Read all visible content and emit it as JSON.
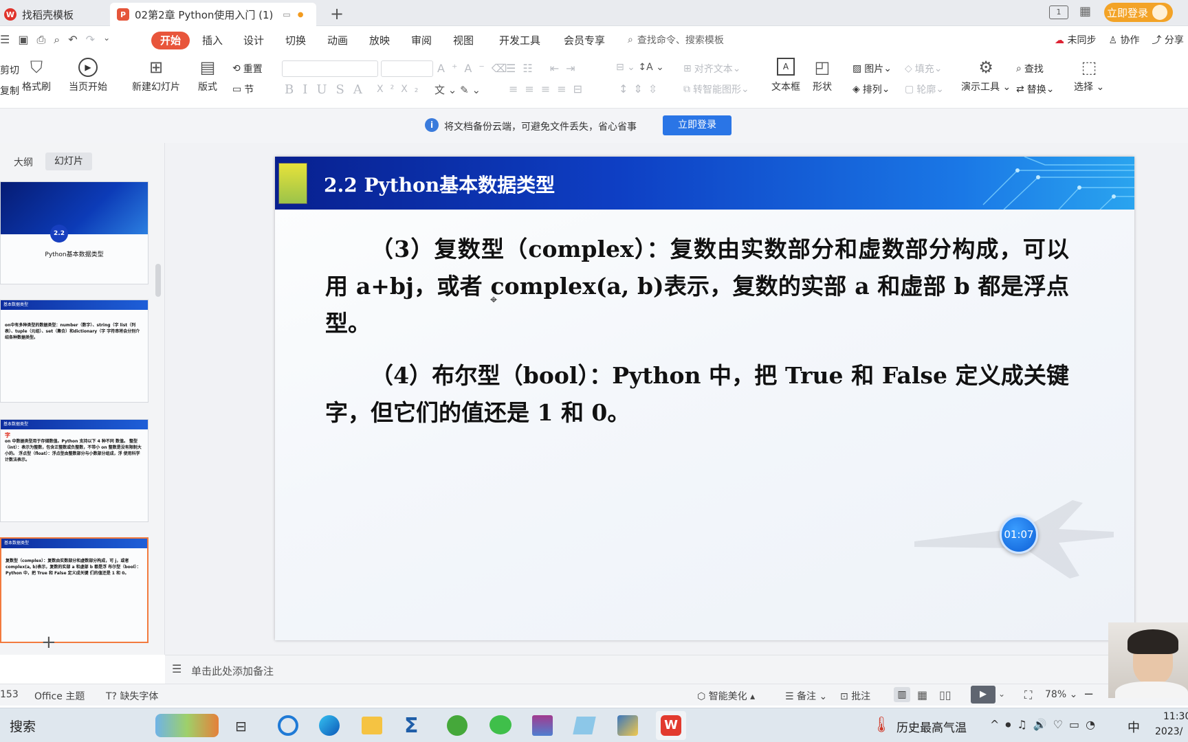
{
  "tabs": [
    {
      "label": "找稻壳模板",
      "icon": "wps-icon"
    },
    {
      "label": "02第2章  Python使用入门 (1)",
      "icon": "ppt-icon"
    }
  ],
  "header_right": {
    "login": "立即登录"
  },
  "ribbon_tabs": [
    "开始",
    "插入",
    "设计",
    "切换",
    "动画",
    "放映",
    "审阅",
    "视图",
    "开发工具",
    "会员专享"
  ],
  "search": {
    "placeholder": "查找命令、搜索模板"
  },
  "top_right": {
    "sync": "未同步",
    "collab": "协作",
    "share": "分享"
  },
  "ribbon": {
    "cut": "剪切",
    "copy": "复制",
    "format_painter": "格式刷",
    "start_from_current": "当页开始",
    "new_slide": "新建幻灯片",
    "layout": "版式",
    "reset": "重置",
    "section": "节",
    "align_text": "对齐文本",
    "smart_art": "转智能图形",
    "textbox": "文本框",
    "shape": "形状",
    "picture": "图片",
    "arrange": "排列",
    "fill": "填充",
    "outline": "轮廓",
    "presentation_tools": "演示工具",
    "find": "查找",
    "replace": "替换",
    "select": "选择"
  },
  "notice": {
    "text": "将文档备份云端，可避免文件丢失，省心省事",
    "button": "立即登录"
  },
  "left_panel": {
    "tab_outline": "大纲",
    "tab_slides": "幻灯片",
    "thumb1_badge": "2.2",
    "thumb1_title": "Python基本数据类型",
    "thumb_header": "基本数据类型",
    "thumb2_text": "on中有多种类型的数据类型：number（数字）、string（字 list（列表）、tuple（元组）、set（集合）和dictionary（字 字符串将会分别介绍各种数据类型。",
    "thumb3_heading": "字",
    "thumb3_text": "on 中数据类型用于存储数值。Python 支持以下 4 种不同 数值。 整型（int）：表示为整数，包含正整数或负整数，不带小 on 整数是没有限制大小的。 浮点型（float）：浮点型由整数部分与小数部分组成，浮 使用科学计数法表示。",
    "thumb4_text": "复数型（complex）：复数由实数部分和虚数部分构成，可 j，或者 complex(a, b)表示，复数的实部 a 和虚部 b 都是浮 布尔型（bool）：Python 中，把 True 和 False 定义成关键 们的值还是 1 和 0。"
  },
  "slide": {
    "title": "2.2 Python基本数据类型",
    "paragraph1": "（3）复数型（complex）：复数由实数部分和虚数部分构成，可以用 a+bj，或者 complex(a, b)表示，复数的实部 a 和虚部 b 都是浮点型。",
    "paragraph2": "（4）布尔型（bool）：Python 中，把 True 和 False 定义成关键字，但它们的值还是 1 和 0。",
    "timer": "01:07"
  },
  "notes": {
    "placeholder": "单击此处添加备注"
  },
  "status": {
    "slide_count": "153",
    "theme": "Office 主题",
    "missing_font": "缺失字体",
    "beautify": "智能美化",
    "notes": "备注",
    "comments": "批注",
    "zoom": "78%"
  },
  "taskbar": {
    "search": "搜索",
    "weather": "历史最高气温",
    "ime": "中",
    "time": "11:30",
    "date": "2023/"
  }
}
